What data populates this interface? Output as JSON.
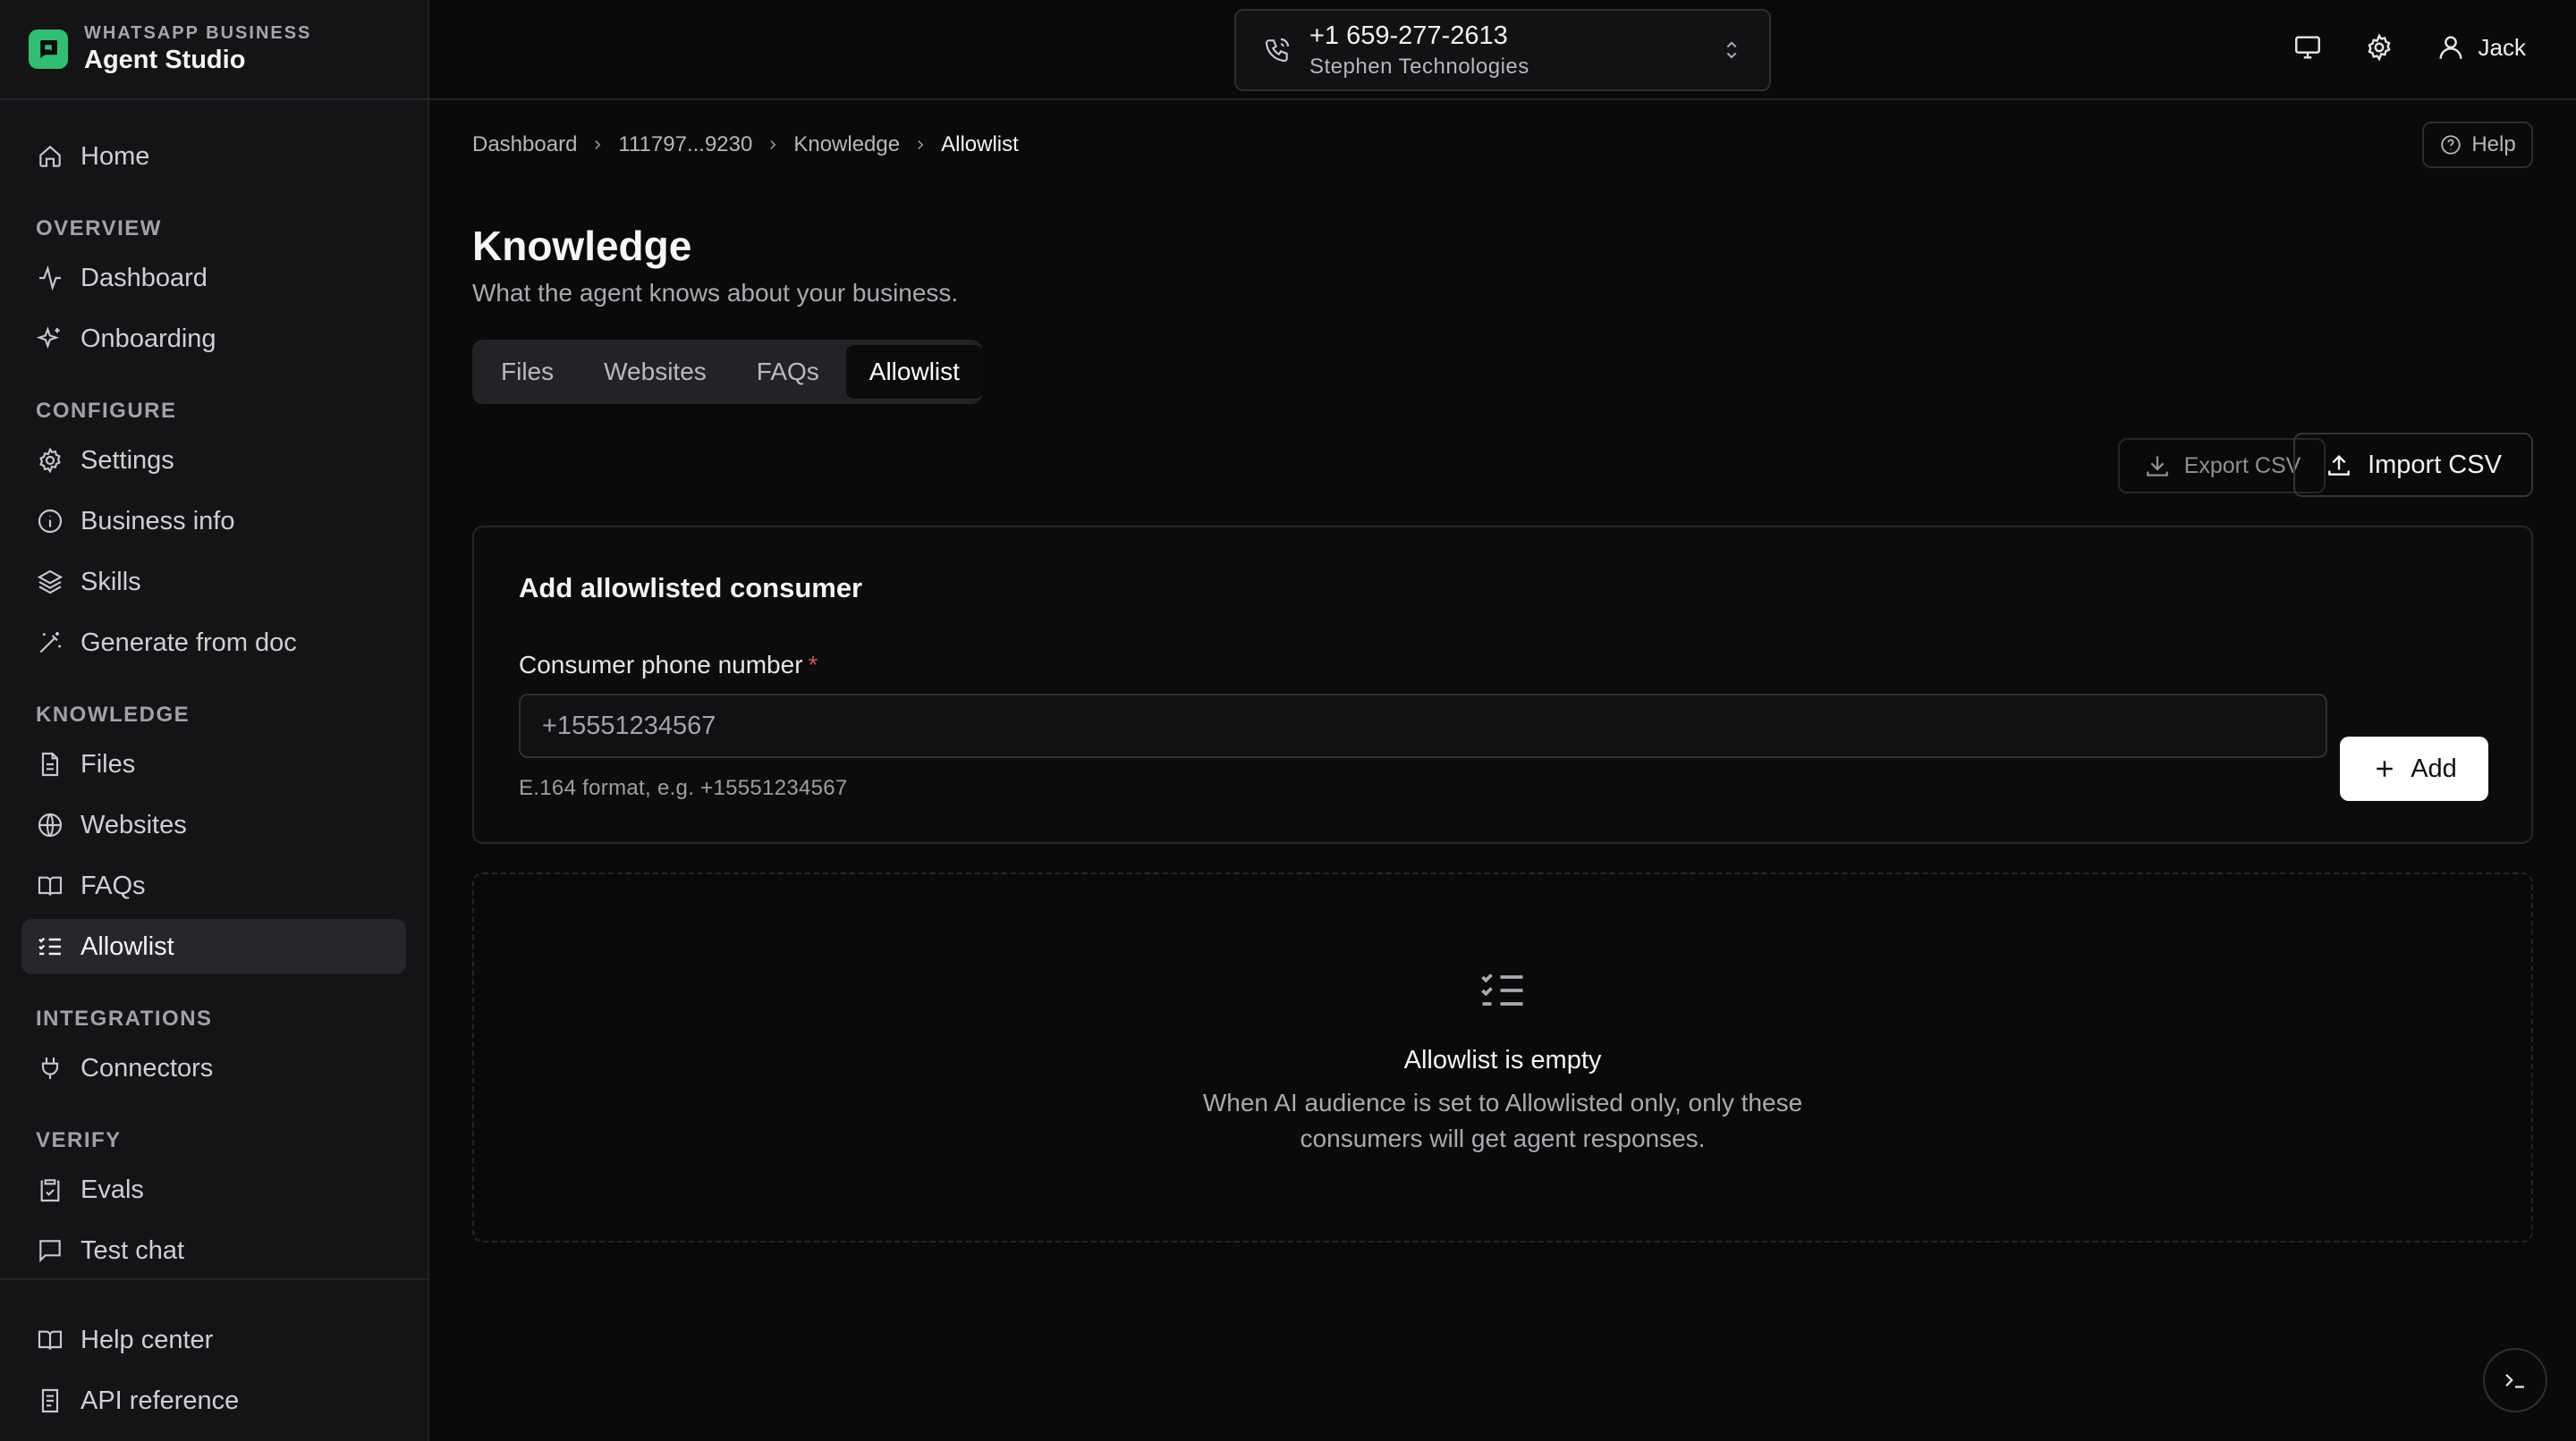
{
  "brand": {
    "subtitle": "WHATSAPP BUSINESS",
    "title": "Agent Studio",
    "accent": "#2fbf71"
  },
  "sidebar": {
    "home": "Home",
    "sections": {
      "overview": "OVERVIEW",
      "configure": "CONFIGURE",
      "knowledge": "KNOWLEDGE",
      "integrations": "INTEGRATIONS",
      "verify": "VERIFY"
    },
    "items": {
      "dashboard": "Dashboard",
      "onboarding": "Onboarding",
      "settings": "Settings",
      "business_info": "Business info",
      "skills": "Skills",
      "generate_from_doc": "Generate from doc",
      "files": "Files",
      "websites": "Websites",
      "faqs": "FAQs",
      "allowlist": "Allowlist",
      "connectors": "Connectors",
      "evals": "Evals",
      "test_chat": "Test chat"
    },
    "bottom": {
      "help_center": "Help center",
      "api_reference": "API reference"
    }
  },
  "header": {
    "phone_number": "+1 659-277-2613",
    "company": "Stephen Technologies",
    "user_name": "Jack"
  },
  "breadcrumb": [
    "Dashboard",
    "111797...9230",
    "Knowledge",
    "Allowlist"
  ],
  "help_label": "Help",
  "page": {
    "title": "Knowledge",
    "subtitle": "What the agent knows about your business."
  },
  "tabs": {
    "files": "Files",
    "websites": "Websites",
    "faqs": "FAQs",
    "allowlist": "Allowlist",
    "active": "Allowlist"
  },
  "actions": {
    "export_csv": "Export CSV",
    "import_csv": "Import CSV"
  },
  "form": {
    "title": "Add allowlisted consumer",
    "label": "Consumer phone number",
    "required_mark": "*",
    "placeholder": "+15551234567",
    "hint": "E.164 format, e.g. +15551234567",
    "add_label": "Add"
  },
  "empty_state": {
    "title": "Allowlist is empty",
    "description": "When AI audience is set to Allowlisted only, only these consumers will get agent responses."
  }
}
